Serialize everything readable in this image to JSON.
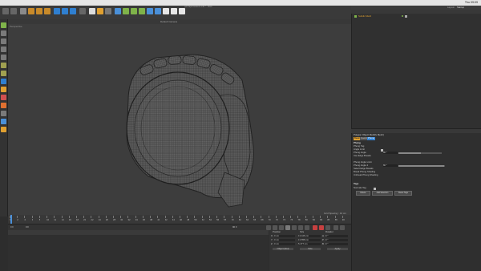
{
  "menubar": {
    "app": "Cinema 4D",
    "items": [
      "File",
      "Edit",
      "Create",
      "Modes",
      "Select",
      "Tools",
      "Mesh",
      "Spline",
      "Volume",
      "MoGraph",
      "Character",
      "Animate",
      "Simulate",
      "Tracker",
      "Render",
      "Extensions",
      "Window",
      "Help"
    ],
    "clock": "Thu 09:09"
  },
  "document_title": "pdf-Tapemeasure.c4d * - Main",
  "viewport": {
    "menu": [
      "View",
      "Cameras",
      "Display",
      "Options",
      "Filter",
      "Panel",
      "ProRender"
    ],
    "label": "Perspective",
    "camera": "Default Camera",
    "grid_spacing": "Grid Spacing : 10 cm"
  },
  "timeline": {
    "ticks": [
      "0",
      "2",
      "4",
      "6",
      "8",
      "10",
      "12",
      "14",
      "16",
      "18",
      "20",
      "22",
      "24",
      "26",
      "28",
      "30",
      "32",
      "34",
      "36",
      "38",
      "40",
      "42",
      "44",
      "46",
      "48",
      "50",
      "52",
      "54",
      "56",
      "58",
      "60",
      "62",
      "64",
      "66",
      "68",
      "70",
      "72",
      "74",
      "76",
      "78",
      "80",
      "82",
      "84",
      "86",
      "88",
      "90"
    ],
    "current": "0 F",
    "start": "0 F",
    "end": "90 F"
  },
  "material": {
    "menu": [
      "Create",
      "Edit",
      "View",
      "Select",
      "Material",
      "Texture"
    ]
  },
  "coordinates": {
    "headers": [
      "Position",
      "Size",
      "Rotation"
    ],
    "rows": [
      {
        "axis": "X",
        "pos": "0 cm",
        "size": "13.426 cm",
        "rot_label": "H",
        "rot": "0 °"
      },
      {
        "axis": "Y",
        "pos": "0 cm",
        "size": "13.858 cm",
        "rot_label": "P",
        "rot": "0 °"
      },
      {
        "axis": "Z",
        "pos": "0 cm",
        "size": "5.477 cm",
        "rot_label": "B",
        "rot": "0 °"
      }
    ],
    "mode_select": "Object (Rel)",
    "size_select": "Size",
    "apply": "Apply"
  },
  "object_manager": {
    "layout_label": "Layout:",
    "layout_value": "Startup",
    "menu": [
      "File",
      "Edit",
      "View",
      "Object",
      "Tags",
      "Bookmarks"
    ],
    "objects": [
      {
        "name": "Subdiv Mesh"
      }
    ]
  },
  "attributes": {
    "menu": [
      "Mode",
      "Edit",
      "User Data"
    ],
    "object_label": "Polygon Object [Subdiv Mesh]",
    "tabs": [
      "Basic",
      "Coord.",
      "Phong"
    ],
    "section": "Phong",
    "fields": [
      {
        "label": "Phong Tag",
        "value": ""
      },
      {
        "label": "Angle Limit",
        "value": ""
      },
      {
        "label": "Phong Angle",
        "value": "80 °"
      },
      {
        "label": "Use Edge Breaks",
        "value": ""
      },
      {
        "label": "Phong Angle Limit",
        "value": ""
      },
      {
        "label": "Phong Angle 2",
        "value": "80 °"
      },
      {
        "label": "Select Edge Breaks",
        "value": ""
      },
      {
        "label": "Break Phong Shading",
        "value": ""
      },
      {
        "label": "Unbreak Phong Shading",
        "value": ""
      }
    ],
    "tags_section": "Tags",
    "normals_label": "Normals Tag",
    "buttons": [
      "Delete",
      "Add Selection",
      "Reset Tags"
    ]
  },
  "colors": {
    "accent": "#e0a030",
    "active_icon": "#2f7fd0",
    "highlight": "#7fb34a"
  }
}
